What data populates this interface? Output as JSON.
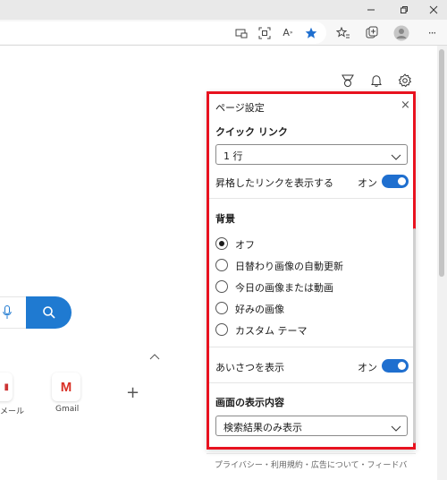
{
  "browser": {
    "window_controls": [
      "minimize-icon",
      "maximize-icon",
      "close-icon"
    ],
    "toolbar_icons": [
      "pip-icon",
      "screenshot-icon",
      "read-aloud-icon",
      "favorite-star-icon",
      "favorites-icon",
      "collections-icon",
      "profile-icon",
      "more-icon"
    ],
    "read_aloud_label": "A",
    "more_label": "···",
    "accent": "#1f7ad1"
  },
  "page": {
    "top_icons": [
      "rewards-icon",
      "notifications-icon",
      "settings-icon"
    ],
    "tiles": [
      {
        "label": "メール"
      },
      {
        "label": "Gmail",
        "glyph": "M"
      }
    ],
    "add_tile_label": "+"
  },
  "panel": {
    "title": "ページ設定",
    "close_label": "×",
    "quick_links_heading": "クイック リンク",
    "quick_links_select_value": "1 行",
    "promoted_links_label": "昇格したリンクを表示する",
    "promoted_links_state": "オン",
    "background_heading": "背景",
    "background_options": [
      {
        "label": "オフ",
        "selected": true
      },
      {
        "label": "日替わり画像の自動更新",
        "selected": false
      },
      {
        "label": "今日の画像または動画",
        "selected": false
      },
      {
        "label": "好みの画像",
        "selected": false
      },
      {
        "label": "カスタム テーマ",
        "selected": false
      }
    ],
    "greeting_label": "あいさつを表示",
    "greeting_state": "オン",
    "content_heading": "画面の表示内容",
    "content_select_value": "検索結果のみ表示",
    "highlight_color": "#e8121f",
    "toggle_color": "#1f6fcf"
  },
  "footer": {
    "text": "プライバシー・利用規約・広告について・フィードバ"
  }
}
